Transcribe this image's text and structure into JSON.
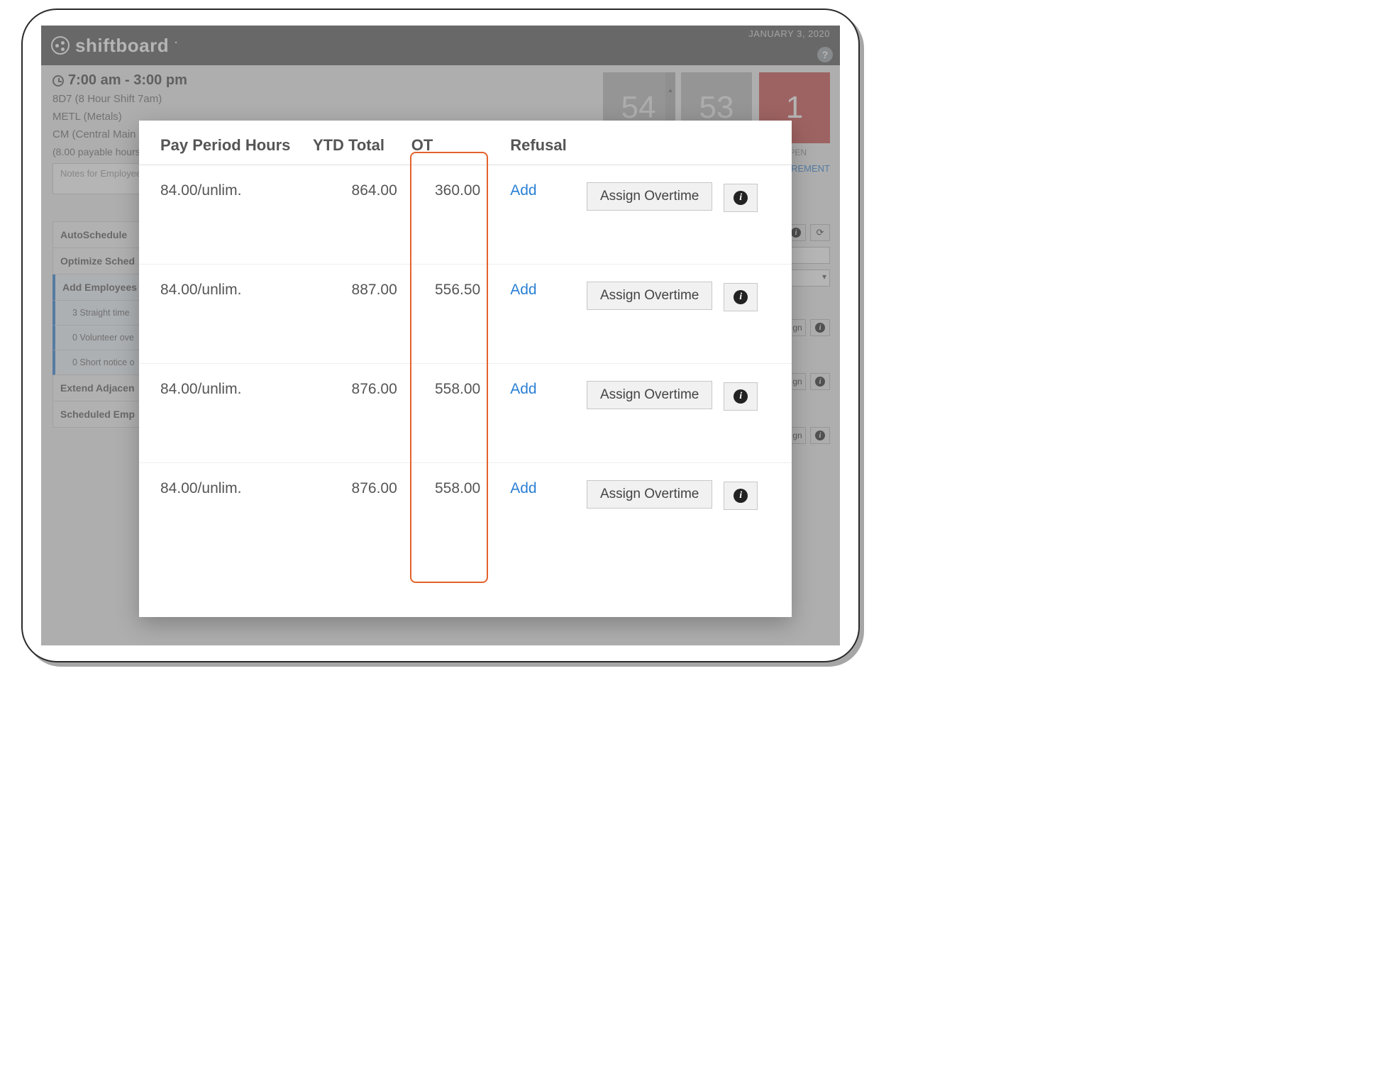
{
  "header": {
    "brand": "shiftboard",
    "date": "JANUARY 3, 2020"
  },
  "shift": {
    "time": "7:00 am - 3:00 pm",
    "code": "8D7 (8 Hour Shift 7am)",
    "dept": "METL (Metals)",
    "loc": "CM (Central Main",
    "payable": "(8.00 payable hours)",
    "notes_placeholder": "Notes for Employee"
  },
  "tiles": {
    "t1": "54",
    "t2": "53",
    "t3": "1",
    "t3_label": "OPEN"
  },
  "req_link": "REQUIREMENT",
  "sidebar": {
    "auto": "AutoSchedule",
    "opt": "Optimize Sched",
    "add": "Add Employees",
    "sub1": "3 Straight time",
    "sub2": "0 Volunteer ove",
    "sub3": "0 Short notice o",
    "ext": "Extend Adjacen",
    "sched": "Scheduled Emp"
  },
  "right": {
    "gn": "gn"
  },
  "modal": {
    "headers": {
      "pph": "Pay Period Hours",
      "ytd": "YTD Total",
      "ot": "OT",
      "ref": "Refusal"
    },
    "add_label": "Add",
    "assign_label": "Assign Overtime",
    "rows": [
      {
        "pph": "84.00/unlim.",
        "ytd": "864.00",
        "ot": "360.00"
      },
      {
        "pph": "84.00/unlim.",
        "ytd": "887.00",
        "ot": "556.50"
      },
      {
        "pph": "84.00/unlim.",
        "ytd": "876.00",
        "ot": "558.00"
      },
      {
        "pph": "84.00/unlim.",
        "ytd": "876.00",
        "ot": "558.00"
      }
    ]
  }
}
